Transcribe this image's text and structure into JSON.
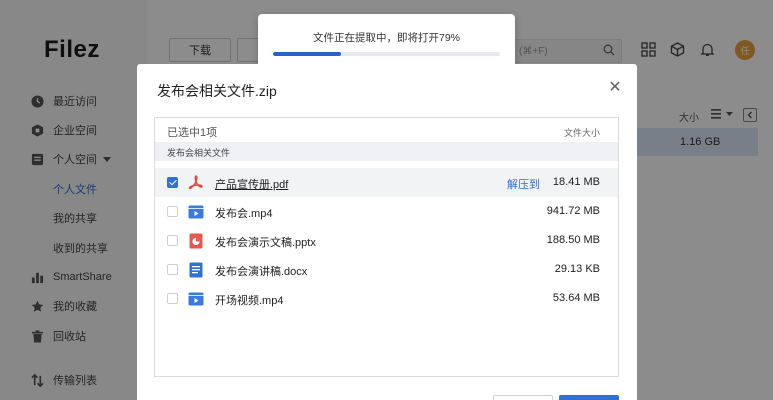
{
  "app": {
    "logo": "Filez"
  },
  "sidebar": {
    "items": [
      {
        "label": "最近访问",
        "icon": "clock-icon"
      },
      {
        "label": "企业空间",
        "icon": "building-icon"
      },
      {
        "label": "个人空间",
        "icon": "folder-icon"
      },
      {
        "label": "个人文件"
      },
      {
        "label": "我的共享"
      },
      {
        "label": "收到的共享"
      },
      {
        "label": "SmartShare",
        "icon": "bar-chart-icon"
      },
      {
        "label": "我的收藏",
        "icon": "star-icon"
      },
      {
        "label": "回收站",
        "icon": "trash-icon"
      },
      {
        "label": "传输列表",
        "icon": "transfer-icon"
      }
    ]
  },
  "toolbar": {
    "download_label": "下载",
    "search_placeholder": "(⌘+F)",
    "avatar_text": "任"
  },
  "file_list": {
    "size_header": "大小",
    "row_size": "1.16 GB"
  },
  "toast": {
    "message": "文件正在提取中，即将打开79%",
    "progress": 0.3
  },
  "dialog": {
    "title": "发布会相关文件.zip",
    "selected_count": "已选中1项",
    "size_header": "文件大小",
    "folder_name": "发布会相关文件",
    "files": [
      {
        "name": "产品宣传册.pdf",
        "size": "18.41 MB",
        "checked": true,
        "action": "解压到",
        "icon": "pdf-icon"
      },
      {
        "name": "发布会.mp4",
        "size": "941.72 MB",
        "checked": false,
        "icon": "video-icon"
      },
      {
        "name": "发布会演示文稿.pptx",
        "size": "188.50 MB",
        "checked": false,
        "icon": "pptx-icon"
      },
      {
        "name": "发布会演讲稿.docx",
        "size": "29.13 KB",
        "checked": false,
        "icon": "docx-icon"
      },
      {
        "name": "开场视频.mp4",
        "size": "53.64 MB",
        "checked": false,
        "icon": "video-icon"
      }
    ]
  },
  "colors": {
    "accent": "#2f6fd6",
    "pdf": "#e0463c",
    "video": "#3b7be0",
    "pptx": "#e5584e",
    "docx": "#2f6fd6",
    "avatar": "#e8a23a"
  }
}
